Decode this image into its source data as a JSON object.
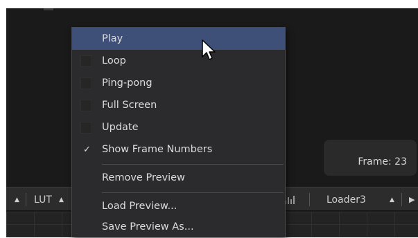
{
  "frame_overlay": {
    "label": "Frame: 23"
  },
  "toolbar": {
    "lut_label": "LUT",
    "view_label": "Loader3",
    "arrow_up": "▲",
    "arrow_right": "▶"
  },
  "context_menu": {
    "items": [
      {
        "label": "Play",
        "highlighted": true
      },
      {
        "label": "Loop",
        "checkbox": true,
        "checked": false
      },
      {
        "label": "Ping-pong",
        "checkbox": true,
        "checked": false
      },
      {
        "label": "Full Screen",
        "checkbox": true,
        "checked": false
      },
      {
        "label": "Update",
        "checkbox": true,
        "checked": false
      },
      {
        "label": "Show Frame Numbers",
        "checkbox": true,
        "checked": true,
        "check_glyph": "✓"
      },
      {
        "label": "Remove Preview"
      },
      {
        "label": "Load Preview..."
      },
      {
        "label": "Save Preview As..."
      }
    ]
  },
  "colors": {
    "highlight": "#3f5078",
    "menu_bg": "#2b2b2d",
    "viewer_bg": "#1a1a1a"
  },
  "cursor_icon": "arrow-pointer-icon"
}
